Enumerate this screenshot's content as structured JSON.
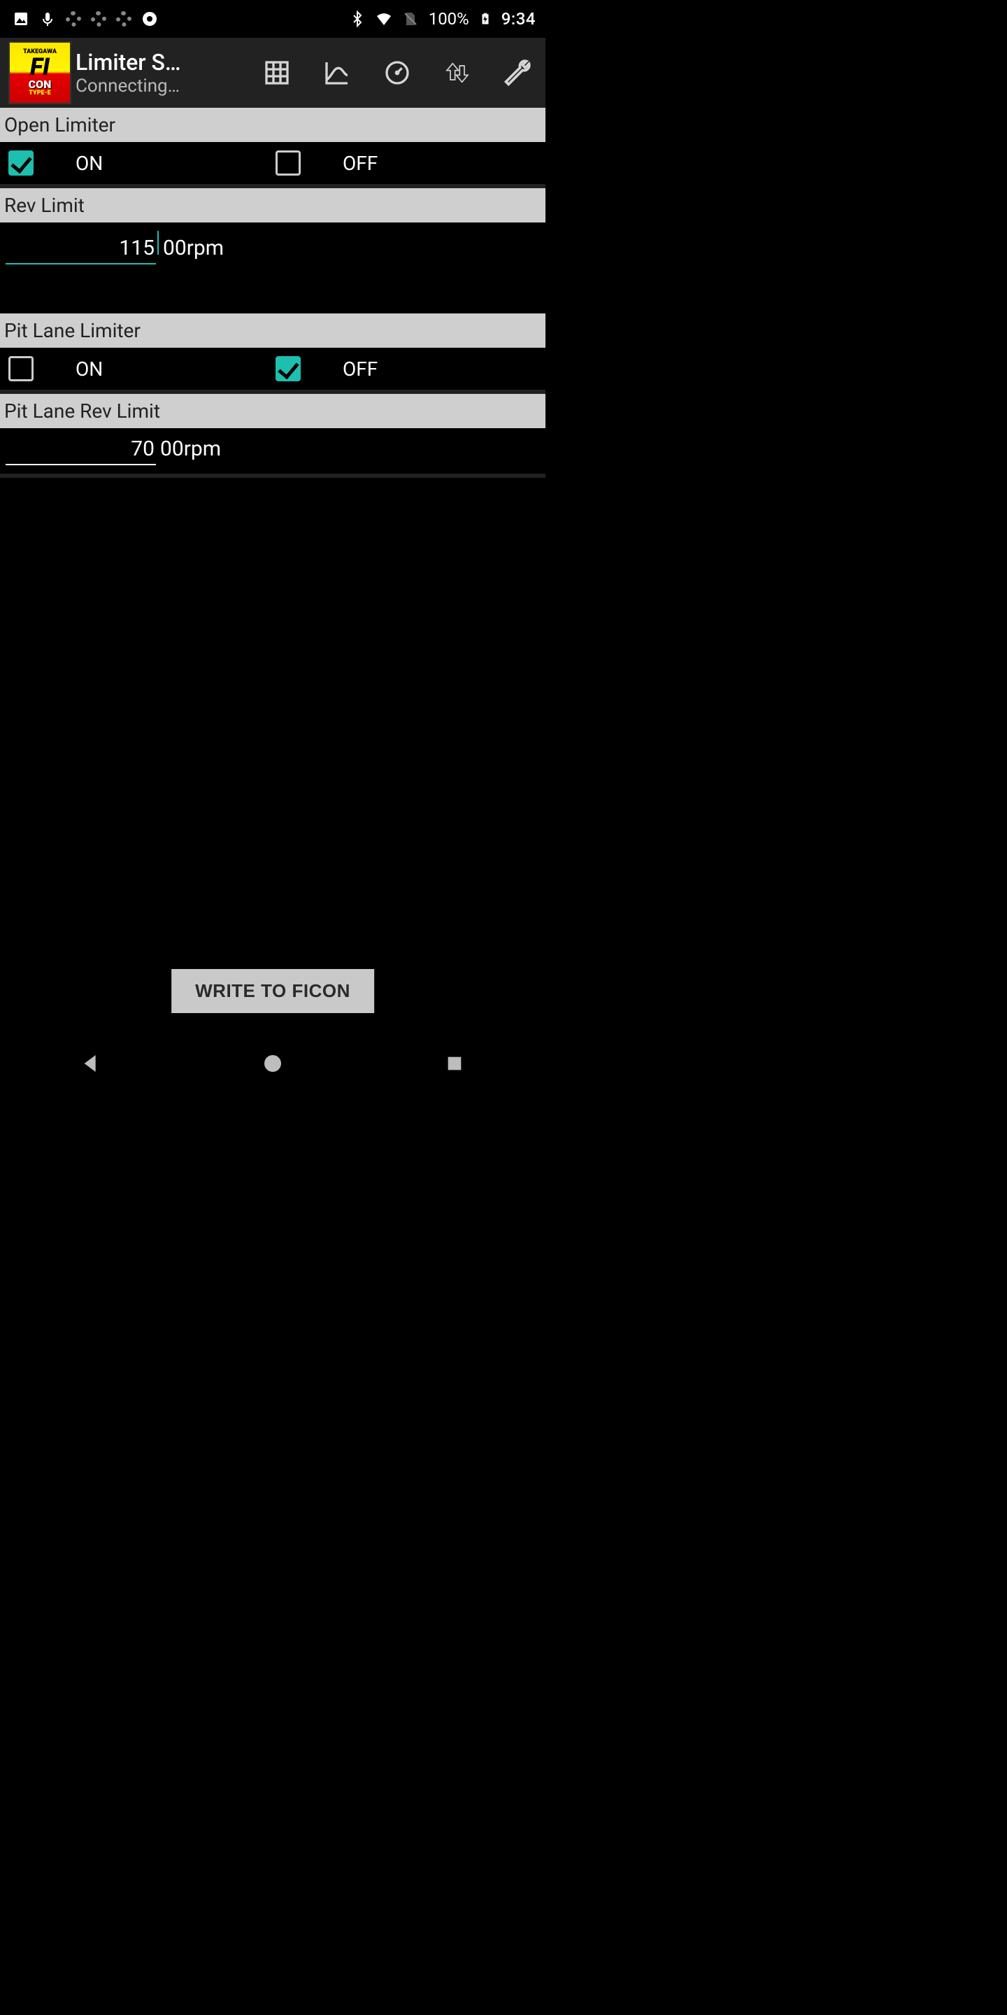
{
  "status": {
    "battery_pct": "100%",
    "time": "9:34"
  },
  "appbar": {
    "title": "Limiter S…",
    "subtitle": "Connecting…"
  },
  "sections": {
    "open_limiter": {
      "header": "Open Limiter",
      "on_label": "ON",
      "off_label": "OFF",
      "on_checked": true,
      "off_checked": false
    },
    "rev_limit": {
      "header": "Rev Limit",
      "value": "115",
      "suffix": "00rpm"
    },
    "pit_lane_limiter": {
      "header": "Pit Lane Limiter",
      "on_label": "ON",
      "off_label": "OFF",
      "on_checked": false,
      "off_checked": true
    },
    "pit_lane_rev_limit": {
      "header": "Pit Lane Rev Limit",
      "value": "70",
      "suffix": "00rpm"
    }
  },
  "footer": {
    "write_button": "WRITE TO FICON"
  },
  "colors": {
    "accent": "#1dbfaf",
    "header_bg": "#cfcfcf"
  }
}
